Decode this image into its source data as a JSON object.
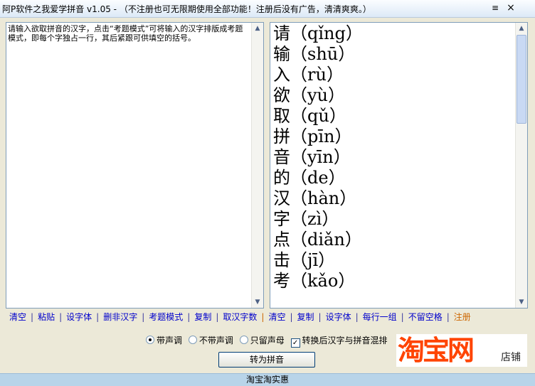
{
  "window": {
    "title": "阿P软件之我爱学拼音 v1.05 - （不注册也可无限期使用全部功能！注册后没有广告，清清爽爽。）",
    "menu_icon": "≡",
    "close_icon": "×"
  },
  "left_pane": {
    "text": "请输入欲取拼音的汉字，点击“考题模式”可将输入的汉字排版成考题模式，即每个字独占一行，其后紧跟可供填空的括号。"
  },
  "right_pane": {
    "rows": [
      {
        "char": "请",
        "pinyin": "qǐng"
      },
      {
        "char": "输",
        "pinyin": "shū"
      },
      {
        "char": "入",
        "pinyin": "rù"
      },
      {
        "char": "欲",
        "pinyin": "yù"
      },
      {
        "char": "取",
        "pinyin": "qǔ"
      },
      {
        "char": "拼",
        "pinyin": "pīn"
      },
      {
        "char": "音",
        "pinyin": "yīn"
      },
      {
        "char": "的",
        "pinyin": "de"
      },
      {
        "char": "汉",
        "pinyin": "hàn"
      },
      {
        "char": "字",
        "pinyin": "zì"
      },
      {
        "char": "点",
        "pinyin": "diǎn"
      },
      {
        "char": "击",
        "pinyin": "jī"
      },
      {
        "char": "考",
        "pinyin": "kǎo"
      }
    ]
  },
  "left_links": [
    "清空",
    "粘贴",
    "设字体",
    "删非汉字",
    "考题模式",
    "复制",
    "取汉字数"
  ],
  "right_links": [
    "清空",
    "复制",
    "设字体",
    "每行一组",
    "不留空格",
    "注册"
  ],
  "options": {
    "tone": "带声调",
    "no_tone": "不带声调",
    "initials_only": "只留声母",
    "mix": "转换后汉字与拼音混排",
    "selected": "tone",
    "mix_checked": true
  },
  "convert_button": "转为拼音",
  "ad": {
    "brand": "淘宝网",
    "suffix": "店铺"
  },
  "status_text": "淘宝淘实惠"
}
